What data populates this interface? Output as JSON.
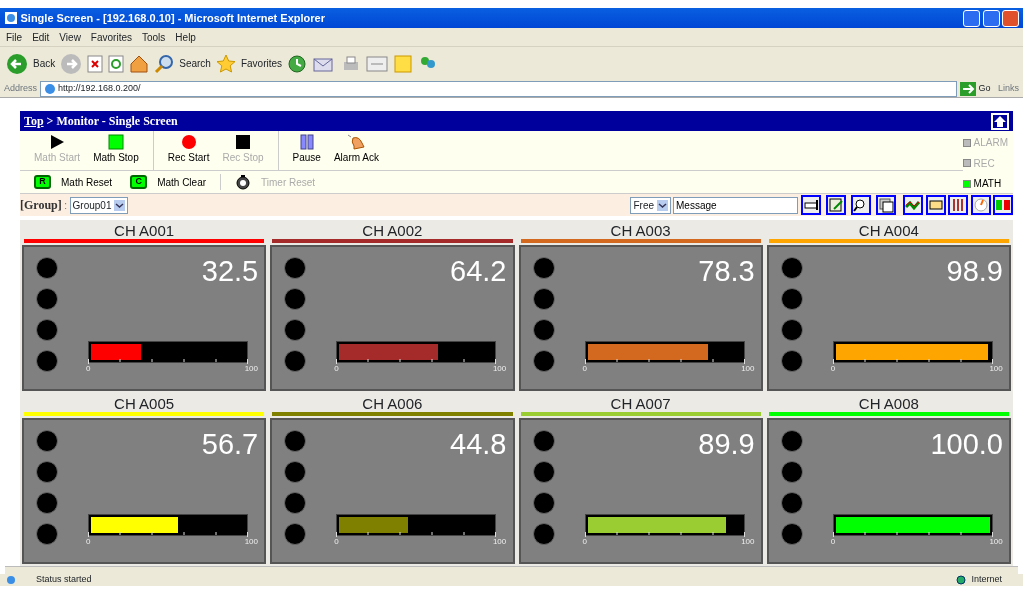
{
  "window": {
    "title": "Single Screen - [192.168.0.10] - Microsoft Internet Explorer"
  },
  "menu": [
    "File",
    "Edit",
    "View",
    "Favorites",
    "Tools",
    "Help"
  ],
  "browser_toolbar": {
    "back": "Back",
    "search": "Search",
    "favorites": "Favorites"
  },
  "address": {
    "label": "Address",
    "value": "http://192.168.0.200/",
    "go": "Go",
    "links": "Links"
  },
  "page": {
    "breadcrumb_link": "Top",
    "breadcrumb_rest": " > Monitor - Single Screen",
    "control_groups": [
      [
        {
          "kind": "play",
          "label": "Math Start",
          "disabled": true
        },
        {
          "kind": "green-square",
          "label": "Math Stop",
          "disabled": false
        }
      ],
      [
        {
          "kind": "record",
          "label": "Rec Start",
          "disabled": false
        },
        {
          "kind": "stop",
          "label": "Rec Stop",
          "disabled": true
        }
      ],
      [
        {
          "kind": "pause",
          "label": "Pause",
          "disabled": false
        },
        {
          "kind": "bell",
          "label": "Alarm Ack",
          "disabled": false
        }
      ]
    ],
    "control_row2": [
      [
        {
          "kind": "letter",
          "letter": "R",
          "label": "Math Reset",
          "disabled": false
        },
        {
          "kind": "letter",
          "letter": "C",
          "label": "Math Clear",
          "disabled": false
        }
      ],
      [
        {
          "kind": "timer",
          "label": "Timer Reset",
          "disabled": true
        }
      ]
    ],
    "status_lamps": [
      {
        "label": "ALARM",
        "on": false
      },
      {
        "label": "REC",
        "on": false
      },
      {
        "label": "MATH",
        "on": true
      }
    ],
    "group_label": "[Group]",
    "group_separator": ":",
    "group_value": "Group01",
    "message_mode": "Free",
    "message_value": "Message",
    "view_buttons": [
      {
        "kind": "bar"
      },
      {
        "kind": "notepad"
      },
      {
        "kind": "magnifier"
      },
      {
        "kind": "window"
      },
      {
        "kind": "trend"
      },
      {
        "kind": "digital"
      },
      {
        "kind": "bars"
      },
      {
        "kind": "meter"
      },
      {
        "kind": "sheet"
      }
    ],
    "channels": [
      {
        "name": "CH A001",
        "color": "#ff0000",
        "value": "32.5",
        "level": 0.325,
        "scale_min": "0",
        "scale_max": "100"
      },
      {
        "name": "CH A002",
        "color": "#a52a2a",
        "value": "64.2",
        "level": 0.642,
        "scale_min": "0",
        "scale_max": "100"
      },
      {
        "name": "CH A003",
        "color": "#d2691e",
        "value": "78.3",
        "level": 0.783,
        "scale_min": "0",
        "scale_max": "100"
      },
      {
        "name": "CH A004",
        "color": "#ffa500",
        "value": "98.9",
        "level": 0.989,
        "scale_min": "0",
        "scale_max": "100"
      },
      {
        "name": "CH A005",
        "color": "#ffff00",
        "value": "56.7",
        "level": 0.567,
        "scale_min": "0",
        "scale_max": "100"
      },
      {
        "name": "CH A006",
        "color": "#808000",
        "value": "44.8",
        "level": 0.448,
        "scale_min": "0",
        "scale_max": "100"
      },
      {
        "name": "CH A007",
        "color": "#9acd32",
        "value": "89.9",
        "level": 0.899,
        "scale_min": "0",
        "scale_max": "100"
      },
      {
        "name": "CH A008",
        "color": "#00ff00",
        "value": "100.0",
        "level": 1.0,
        "scale_min": "0",
        "scale_max": "100"
      }
    ]
  },
  "status_bar": {
    "text": "Status started",
    "zone": "Internet"
  }
}
